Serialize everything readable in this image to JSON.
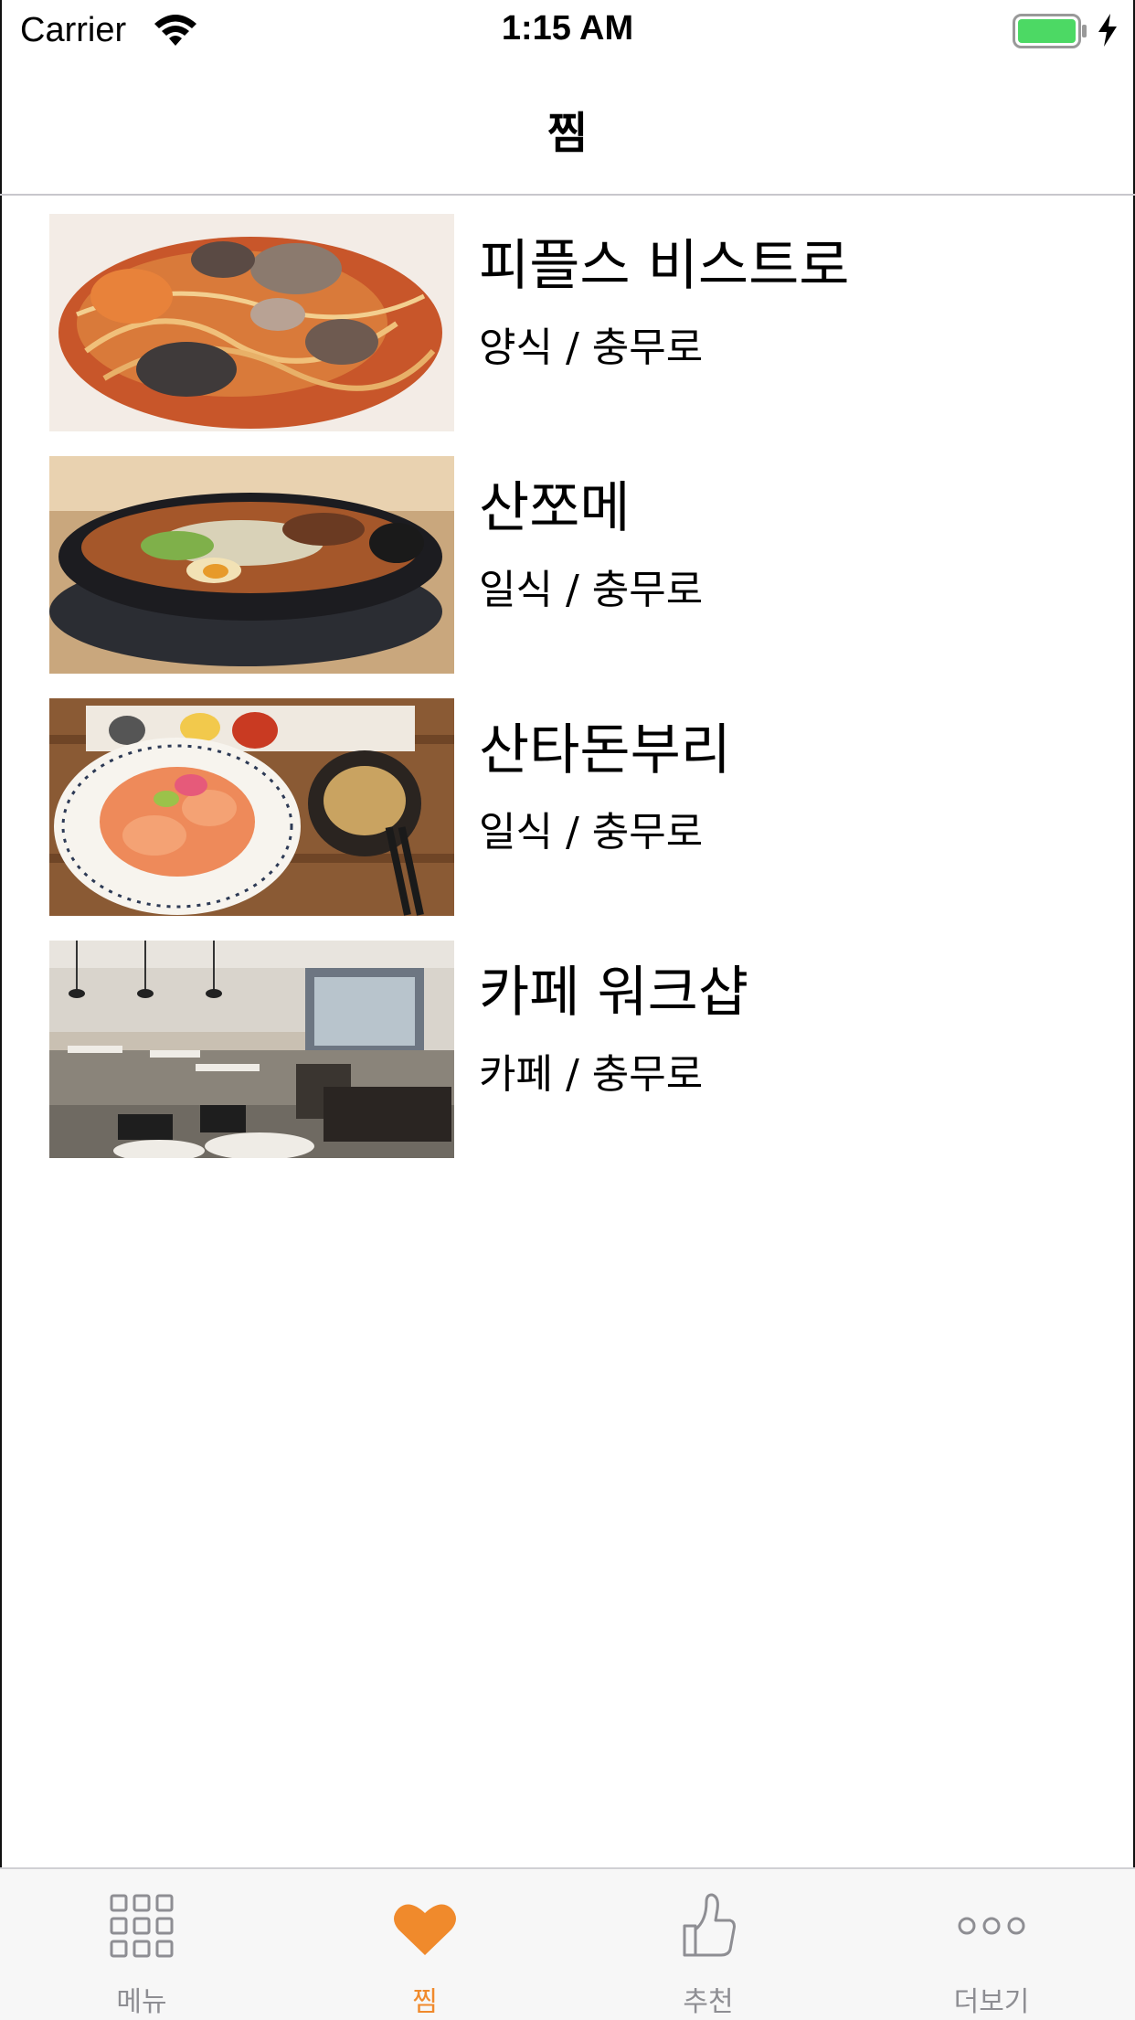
{
  "status_bar": {
    "carrier": "Carrier",
    "time": "1:15 AM"
  },
  "nav": {
    "title": "찜"
  },
  "favorites": [
    {
      "name": "피플스 비스트로",
      "category": "양식 / 충무로",
      "image": "seafood-pasta"
    },
    {
      "name": "산쪼메",
      "category": "일식 / 충무로",
      "image": "ramen-bowl"
    },
    {
      "name": "산타돈부리",
      "category": "일식 / 충무로",
      "image": "salmon-donburi"
    },
    {
      "name": "카페 워크샵",
      "category": "카페 / 충무로",
      "image": "cafe-interior"
    }
  ],
  "tabs": [
    {
      "label": "메뉴",
      "icon": "grid-icon",
      "active": false
    },
    {
      "label": "찜",
      "icon": "heart-icon",
      "active": true
    },
    {
      "label": "추천",
      "icon": "thumbs-up-icon",
      "active": false
    },
    {
      "label": "더보기",
      "icon": "more-icon",
      "active": false
    }
  ],
  "colors": {
    "accent": "#f08a2c",
    "inactive": "#8e8e93",
    "battery": "#4cd964"
  }
}
